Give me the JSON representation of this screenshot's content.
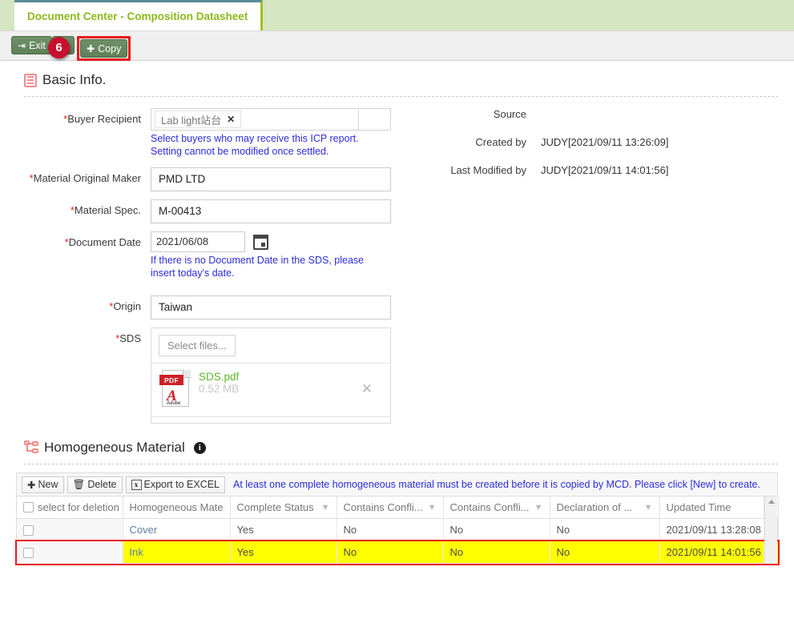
{
  "tab": {
    "label": "Document Center - Composition Datasheet"
  },
  "toolbar": {
    "exit_label": "Exit",
    "save_label": "",
    "copy_label": "Copy",
    "badge": "6",
    "exit_icon": "exit-arrow-icon",
    "save_icon": "save-disk-icon",
    "copy_icon": "plus-icon"
  },
  "basic_info": {
    "title": "Basic Info.",
    "buyer_recipient": {
      "label": "Buyer Recipient",
      "required": true,
      "tags": [
        {
          "text": "Lab light站台",
          "remove": "✕"
        }
      ],
      "hint": "Select buyers who may receive this ICP report. Setting cannot be modified once settled."
    },
    "material_original_maker": {
      "label": "Material Original Maker",
      "required": true,
      "value": "PMD LTD"
    },
    "material_spec": {
      "label": "Material Spec.",
      "required": true,
      "value": "M-00413"
    },
    "document_date": {
      "label": "Document Date",
      "required": true,
      "value": "2021/06/08",
      "hint": "If there is no Document Date in the SDS, please insert today's date."
    },
    "origin": {
      "label": "Origin",
      "required": true,
      "value": "Taiwan"
    },
    "sds": {
      "label": "SDS",
      "required": true,
      "select_files_label": "Select files...",
      "file_name": "SDS.pdf",
      "file_size": "0.52 MB",
      "file_type_badge": "PDF",
      "file_brand": "Adobe",
      "remove_icon": "✕"
    },
    "meta": [
      {
        "label": "Source",
        "value": ""
      },
      {
        "label": "Created by",
        "value": "JUDY[2021/09/11 13:26:09]"
      },
      {
        "label": "Last Modified by",
        "value": "JUDY[2021/09/11 14:01:56]"
      }
    ]
  },
  "homogeneous_material": {
    "title": "Homogeneous Material",
    "info_icon": "i",
    "grid_toolbar": {
      "new_label": "New",
      "delete_label": "Delete",
      "export_label": "Export to EXCEL",
      "export_icon_text": "x",
      "message": "At least one complete homogeneous material must be created before it is copied by MCD. Please click [New] to create."
    },
    "columns": [
      {
        "key": "select",
        "label": "select for deletion",
        "filter": false
      },
      {
        "key": "name",
        "label": "Homogeneous Mate",
        "filter": true
      },
      {
        "key": "complete",
        "label": "Complete Status",
        "filter": true
      },
      {
        "key": "conf1",
        "label": "Contains Confli...",
        "filter": true
      },
      {
        "key": "conf2",
        "label": "Contains Confli...",
        "filter": true
      },
      {
        "key": "decl",
        "label": "Declaration of ...",
        "filter": true
      },
      {
        "key": "updated",
        "label": "Updated Time",
        "filter": false
      }
    ],
    "rows": [
      {
        "highlighted": false,
        "name": "Cover",
        "complete": "Yes",
        "conf1": "No",
        "conf2": "No",
        "decl": "No",
        "updated": "2021/09/11 13:28:08"
      },
      {
        "highlighted": true,
        "name": "Ink",
        "complete": "Yes",
        "conf1": "No",
        "conf2": "No",
        "decl": "No",
        "updated": "2021/09/11 14:01:56"
      }
    ]
  },
  "colors": {
    "tab_text": "#8cb81c",
    "tab_bar": "#d6e5c2",
    "button_green": "#5f8058",
    "hint_blue": "#2c2cdd",
    "highlight_yellow": "#ffff00",
    "highlight_border": "#e8191b",
    "badge_red": "#c8102e",
    "required_red": "#e02020",
    "file_name_green": "#5cb62a"
  }
}
